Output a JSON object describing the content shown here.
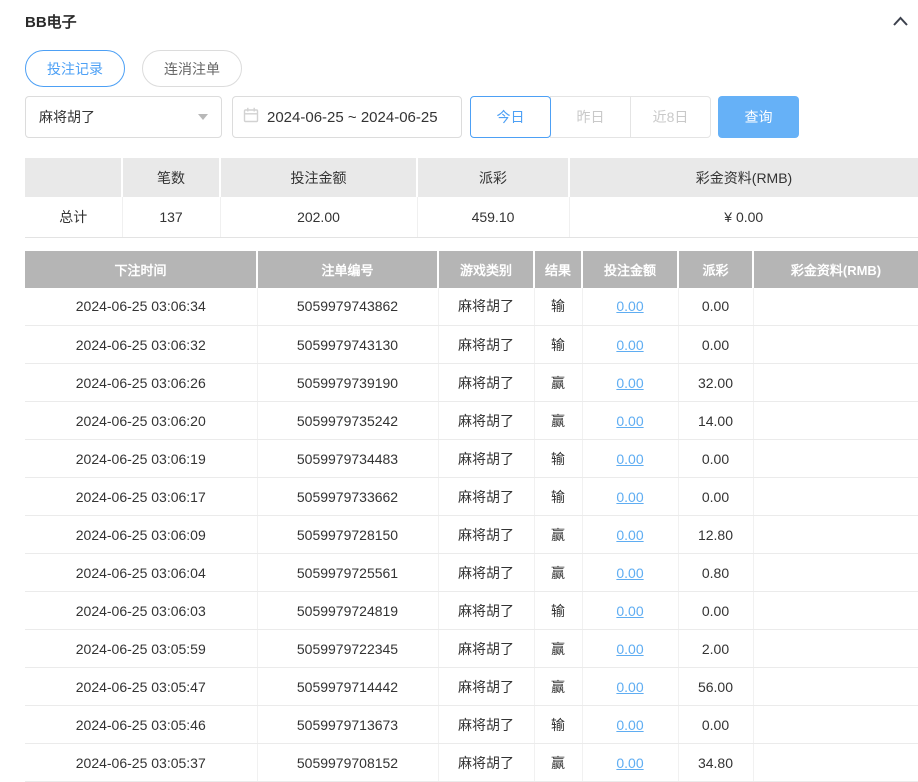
{
  "page": {
    "title": "BB电子"
  },
  "tabs": [
    {
      "label": "投注记录",
      "active": true
    },
    {
      "label": "连消注单",
      "active": false
    }
  ],
  "filters": {
    "game_select": {
      "value": "麻将胡了"
    },
    "date_range": {
      "value": "2024-06-25 ~ 2024-06-25"
    },
    "quick_ranges": [
      {
        "label": "今日",
        "active": true
      },
      {
        "label": "昨日",
        "active": false
      },
      {
        "label": "近8日",
        "active": false
      }
    ],
    "query_label": "查询"
  },
  "summary": {
    "headers": [
      "",
      "笔数",
      "投注金额",
      "派彩",
      "彩金资料(RMB)"
    ],
    "total": {
      "label": "总计",
      "count": "137",
      "bet_amount": "202.00",
      "payout": "459.10",
      "bonus": "¥ 0.00"
    }
  },
  "records": {
    "headers": [
      "下注时间",
      "注单编号",
      "游戏类别",
      "结果",
      "投注金额",
      "派彩",
      "彩金资料(RMB)"
    ],
    "rows": [
      {
        "time": "2024-06-25 03:06:34",
        "order_id": "5059979743862",
        "game": "麻将胡了",
        "result": "输",
        "bet": "0.00",
        "payout": "0.00",
        "bonus": ""
      },
      {
        "time": "2024-06-25 03:06:32",
        "order_id": "5059979743130",
        "game": "麻将胡了",
        "result": "输",
        "bet": "0.00",
        "payout": "0.00",
        "bonus": ""
      },
      {
        "time": "2024-06-25 03:06:26",
        "order_id": "5059979739190",
        "game": "麻将胡了",
        "result": "赢",
        "bet": "0.00",
        "payout": "32.00",
        "bonus": ""
      },
      {
        "time": "2024-06-25 03:06:20",
        "order_id": "5059979735242",
        "game": "麻将胡了",
        "result": "赢",
        "bet": "0.00",
        "payout": "14.00",
        "bonus": ""
      },
      {
        "time": "2024-06-25 03:06:19",
        "order_id": "5059979734483",
        "game": "麻将胡了",
        "result": "输",
        "bet": "0.00",
        "payout": "0.00",
        "bonus": ""
      },
      {
        "time": "2024-06-25 03:06:17",
        "order_id": "5059979733662",
        "game": "麻将胡了",
        "result": "输",
        "bet": "0.00",
        "payout": "0.00",
        "bonus": ""
      },
      {
        "time": "2024-06-25 03:06:09",
        "order_id": "5059979728150",
        "game": "麻将胡了",
        "result": "赢",
        "bet": "0.00",
        "payout": "12.80",
        "bonus": ""
      },
      {
        "time": "2024-06-25 03:06:04",
        "order_id": "5059979725561",
        "game": "麻将胡了",
        "result": "赢",
        "bet": "0.00",
        "payout": "0.80",
        "bonus": ""
      },
      {
        "time": "2024-06-25 03:06:03",
        "order_id": "5059979724819",
        "game": "麻将胡了",
        "result": "输",
        "bet": "0.00",
        "payout": "0.00",
        "bonus": ""
      },
      {
        "time": "2024-06-25 03:05:59",
        "order_id": "5059979722345",
        "game": "麻将胡了",
        "result": "赢",
        "bet": "0.00",
        "payout": "2.00",
        "bonus": ""
      },
      {
        "time": "2024-06-25 03:05:47",
        "order_id": "5059979714442",
        "game": "麻将胡了",
        "result": "赢",
        "bet": "0.00",
        "payout": "56.00",
        "bonus": ""
      },
      {
        "time": "2024-06-25 03:05:46",
        "order_id": "5059979713673",
        "game": "麻将胡了",
        "result": "输",
        "bet": "0.00",
        "payout": "0.00",
        "bonus": ""
      },
      {
        "time": "2024-06-25 03:05:37",
        "order_id": "5059979708152",
        "game": "麻将胡了",
        "result": "赢",
        "bet": "0.00",
        "payout": "34.80",
        "bonus": ""
      }
    ]
  },
  "colors": {
    "accent": "#4da0f5",
    "query_button_bg": "#66b1f7",
    "amount_link": "#5fadf2",
    "records_header_bg": "#b5b5b5",
    "summary_header_bg": "#e9e9e9"
  }
}
